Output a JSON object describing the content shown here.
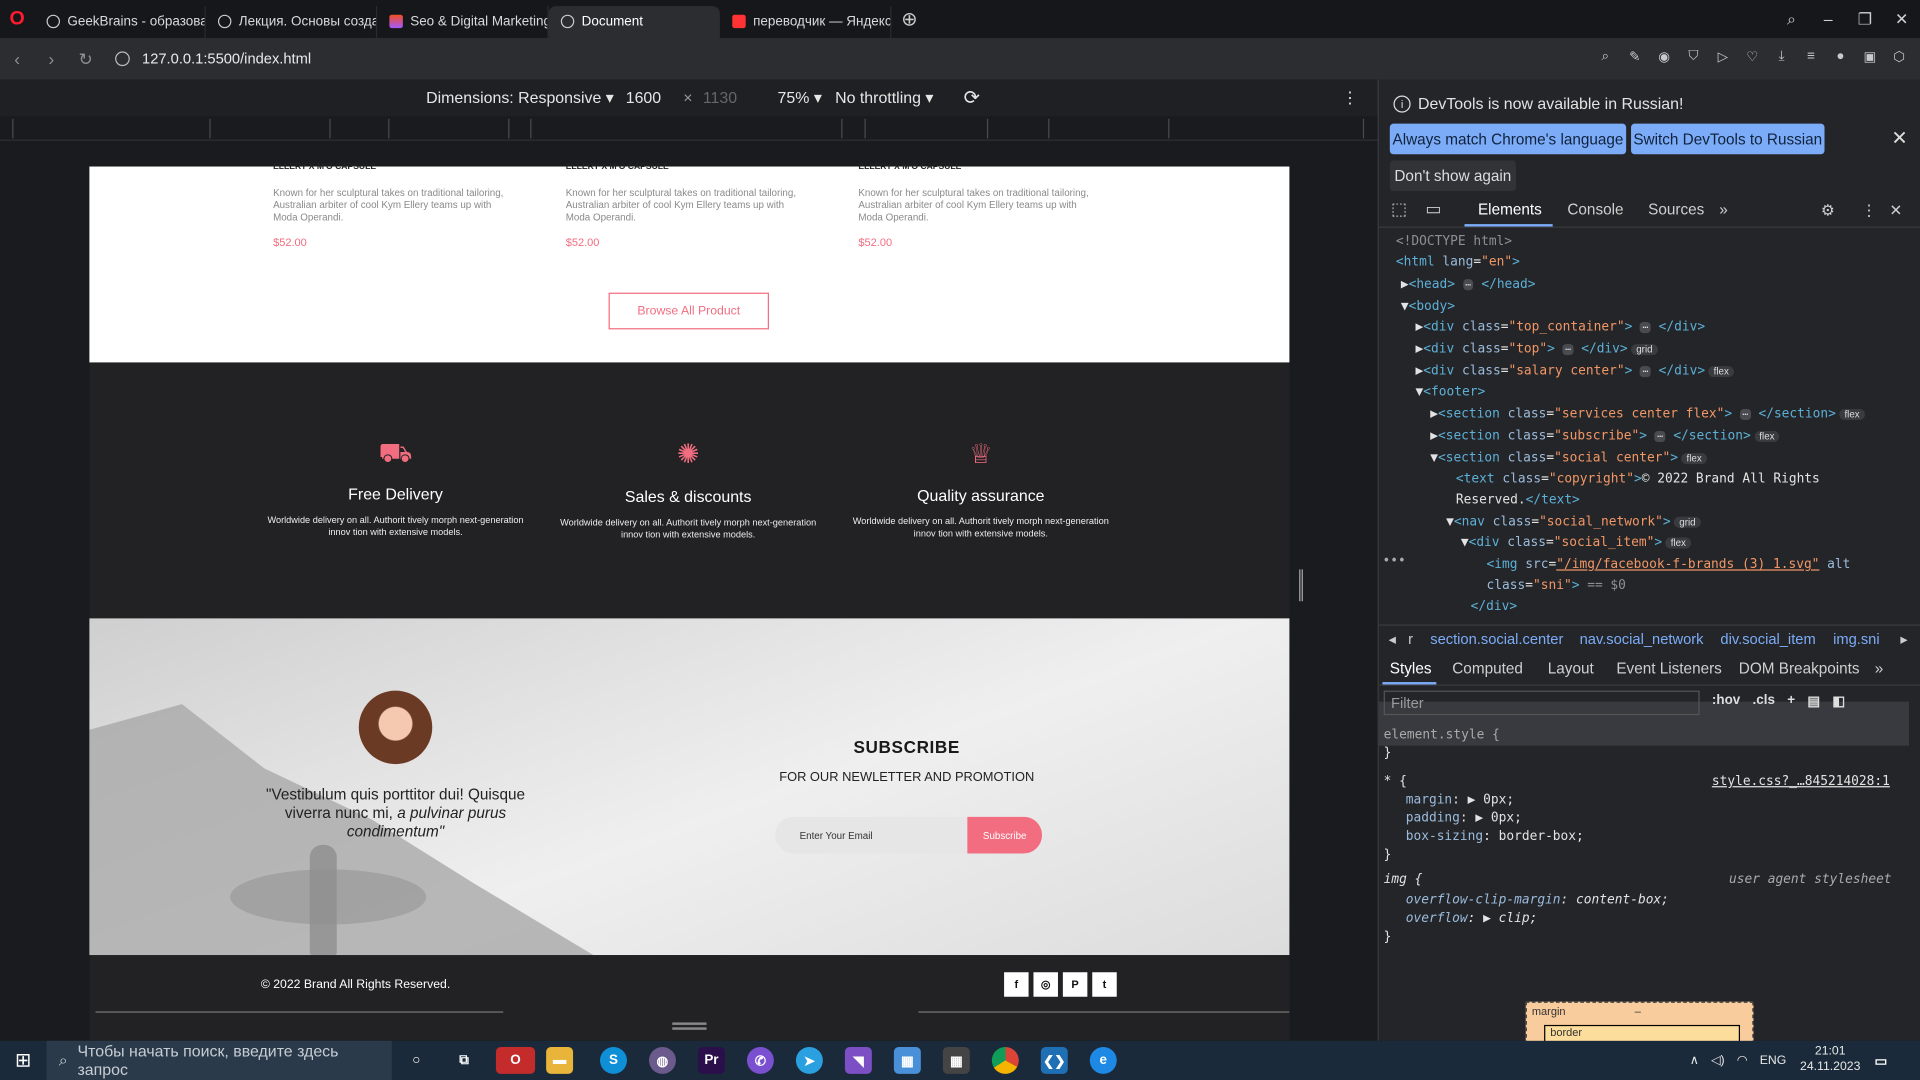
{
  "browser": {
    "tabs": [
      {
        "label": "GeekBrains - образовате",
        "active": false,
        "icon": "globe-icon"
      },
      {
        "label": "Лекция. Основы создани",
        "active": false,
        "icon": "globe-icon"
      },
      {
        "label": "Seo & Digital Marketing L",
        "active": false,
        "icon": "figma-icon"
      },
      {
        "label": "Document",
        "active": true,
        "icon": "globe-icon"
      },
      {
        "label": "переводчик — Яндекс: н",
        "active": false,
        "icon": "yandex-icon"
      }
    ],
    "url": "127.0.0.1:5500/index.html"
  },
  "device_toolbar": {
    "dimensions": "Dimensions: Responsive",
    "width": "1600",
    "times": "×",
    "height": "1130",
    "zoom": "75%",
    "throttling": "No throttling"
  },
  "page": {
    "products": [
      {
        "title": "ELLERY X M'O CAPSULE",
        "desc": "Known for her sculptural takes on traditional tailoring, Australian arbiter of cool Kym Ellery teams up with Moda Operandi.",
        "price": "$52.00"
      },
      {
        "title": "ELLERY X M'O CAPSULE",
        "desc": "Known for her sculptural takes on traditional tailoring, Australian arbiter of cool Kym Ellery teams up with Moda Operandi.",
        "price": "$52.00"
      },
      {
        "title": "ELLERY X M'O CAPSULE",
        "desc": "Known for her sculptural takes on traditional tailoring, Australian arbiter of cool Kym Ellery teams up with Moda Operandi.",
        "price": "$52.00"
      }
    ],
    "browse_label": "Browse All Product",
    "services": [
      {
        "title": "Free Delivery",
        "desc": "Worldwide delivery on all. Authorit tively morph next-generation innov tion with extensive models.",
        "icon": "truck-icon"
      },
      {
        "title": "Sales & discounts",
        "desc": "Worldwide delivery on all. Authorit tively morph next-generation innov tion with extensive models.",
        "icon": "percent-icon"
      },
      {
        "title": "Quality assurance",
        "desc": "Worldwide delivery on all. Authorit tively morph next-generation innov tion with extensive models.",
        "icon": "crown-icon"
      }
    ],
    "quote_line1": "\"Vestibulum quis porttitor dui! Quisque viverra nunc mi,",
    "quote_italic": "a pulvinar purus condimentum\"",
    "subscribe_title": "SUBSCRIBE",
    "subscribe_text": "FOR OUR NEWLETTER AND PROMOTION",
    "email_placeholder": "Enter Your Email",
    "subscribe_button": "Subscribe",
    "copyright": "© 2022 Brand All Rights Reserved.",
    "social": [
      "f",
      "◎",
      "P",
      "t"
    ]
  },
  "devtools": {
    "notice": "DevTools is now available in Russian!",
    "btn_match": "Always match Chrome's language",
    "btn_switch": "Switch DevTools to Russian",
    "btn_dont": "Don't show again",
    "tabs": [
      "Elements",
      "Console",
      "Sources"
    ],
    "breadcrumbs": [
      "r",
      "section.social.center",
      "nav.social_network",
      "div.social_item",
      "img.sni"
    ],
    "subtabs": [
      "Styles",
      "Computed",
      "Layout",
      "Event Listeners",
      "DOM Breakpoints"
    ],
    "filter_placeholder": "Filter",
    "hov": ":hov",
    "cls": ".cls",
    "style_source": "style.css?_…845214028:1",
    "ua": "user agent stylesheet",
    "margin_label": "margin",
    "border_label": "border",
    "dash": "–"
  },
  "taskbar": {
    "search_placeholder": "Чтобы начать поиск, введите здесь запрос",
    "lang": "ENG",
    "time": "21:01",
    "date": "24.11.2023"
  },
  "colors": {
    "accent": "#f16d7f",
    "devtools_blue": "#7cacf8"
  }
}
